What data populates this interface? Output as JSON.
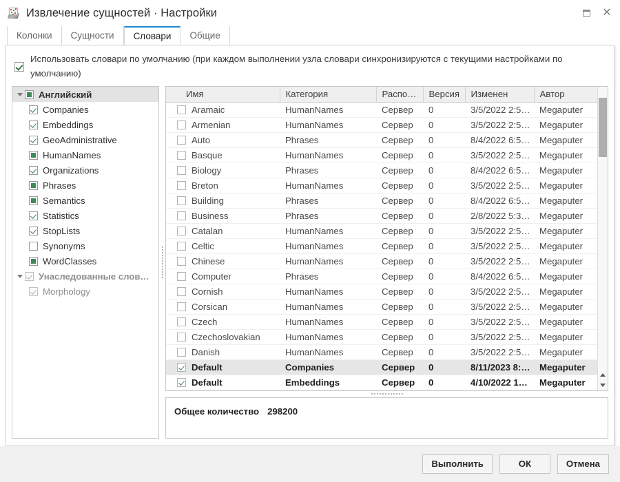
{
  "window": {
    "title": "Извлечение сущностей · Настройки",
    "icon": "app-icon",
    "restore_label": "▣",
    "close_label": "✕"
  },
  "tabs": [
    {
      "label": "Колонки",
      "active": false
    },
    {
      "label": "Сущности",
      "active": false
    },
    {
      "label": "Словари",
      "active": true
    },
    {
      "label": "Общие",
      "active": false
    }
  ],
  "default_dicts": {
    "checked": true,
    "label": "Использовать словари по умолчанию (при каждом выполнении узла словари синхронизируются с текущими настройками по умолчанию)"
  },
  "tree": [
    {
      "label": "Английский",
      "state": "filled",
      "level": 0,
      "expanded": true,
      "selected": true,
      "dim": false
    },
    {
      "label": "Companies",
      "state": "checked",
      "level": 1,
      "dim": false
    },
    {
      "label": "Embeddings",
      "state": "checked",
      "level": 1,
      "dim": false
    },
    {
      "label": "GeoAdministrative",
      "state": "checked",
      "level": 1,
      "dim": false
    },
    {
      "label": "HumanNames",
      "state": "filled",
      "level": 1,
      "dim": false
    },
    {
      "label": "Organizations",
      "state": "checked",
      "level": 1,
      "dim": false
    },
    {
      "label": "Phrases",
      "state": "filled",
      "level": 1,
      "dim": false
    },
    {
      "label": "Semantics",
      "state": "filled",
      "level": 1,
      "dim": false
    },
    {
      "label": "Statistics",
      "state": "checked",
      "level": 1,
      "dim": false
    },
    {
      "label": "StopLists",
      "state": "checked",
      "level": 1,
      "dim": false
    },
    {
      "label": "Synonyms",
      "state": "unchecked",
      "level": 1,
      "dim": false
    },
    {
      "label": "WordClasses",
      "state": "filled",
      "level": 1,
      "dim": false
    },
    {
      "label": "Унаследованные слов…",
      "state": "checked-disabled",
      "level": 0,
      "expanded": true,
      "bold": true,
      "dim": true
    },
    {
      "label": "Morphology",
      "state": "checked-disabled",
      "level": 1,
      "dim": true
    }
  ],
  "table": {
    "columns": [
      "Имя",
      "Категория",
      "Распо…",
      "Версия",
      "Изменен",
      "Автор"
    ],
    "rows": [
      {
        "checked": false,
        "name": "Aramaic",
        "category": "HumanNames",
        "location": "Сервер",
        "version": "0",
        "modified": "3/5/2022 2:5…",
        "author": "Megaputer"
      },
      {
        "checked": false,
        "name": "Armenian",
        "category": "HumanNames",
        "location": "Сервер",
        "version": "0",
        "modified": "3/5/2022 2:5…",
        "author": "Megaputer"
      },
      {
        "checked": false,
        "name": "Auto",
        "category": "Phrases",
        "location": "Сервер",
        "version": "0",
        "modified": "8/4/2022 6:5…",
        "author": "Megaputer"
      },
      {
        "checked": false,
        "name": "Basque",
        "category": "HumanNames",
        "location": "Сервер",
        "version": "0",
        "modified": "3/5/2022 2:5…",
        "author": "Megaputer"
      },
      {
        "checked": false,
        "name": "Biology",
        "category": "Phrases",
        "location": "Сервер",
        "version": "0",
        "modified": "8/4/2022 6:5…",
        "author": "Megaputer"
      },
      {
        "checked": false,
        "name": "Breton",
        "category": "HumanNames",
        "location": "Сервер",
        "version": "0",
        "modified": "3/5/2022 2:5…",
        "author": "Megaputer"
      },
      {
        "checked": false,
        "name": "Building",
        "category": "Phrases",
        "location": "Сервер",
        "version": "0",
        "modified": "8/4/2022 6:5…",
        "author": "Megaputer"
      },
      {
        "checked": false,
        "name": "Business",
        "category": "Phrases",
        "location": "Сервер",
        "version": "0",
        "modified": "2/8/2022 5:3…",
        "author": "Megaputer"
      },
      {
        "checked": false,
        "name": "Catalan",
        "category": "HumanNames",
        "location": "Сервер",
        "version": "0",
        "modified": "3/5/2022 2:5…",
        "author": "Megaputer"
      },
      {
        "checked": false,
        "name": "Celtic",
        "category": "HumanNames",
        "location": "Сервер",
        "version": "0",
        "modified": "3/5/2022 2:5…",
        "author": "Megaputer"
      },
      {
        "checked": false,
        "name": "Chinese",
        "category": "HumanNames",
        "location": "Сервер",
        "version": "0",
        "modified": "3/5/2022 2:5…",
        "author": "Megaputer"
      },
      {
        "checked": false,
        "name": "Computer",
        "category": "Phrases",
        "location": "Сервер",
        "version": "0",
        "modified": "8/4/2022 6:5…",
        "author": "Megaputer"
      },
      {
        "checked": false,
        "name": "Cornish",
        "category": "HumanNames",
        "location": "Сервер",
        "version": "0",
        "modified": "3/5/2022 2:5…",
        "author": "Megaputer"
      },
      {
        "checked": false,
        "name": "Corsican",
        "category": "HumanNames",
        "location": "Сервер",
        "version": "0",
        "modified": "3/5/2022 2:5…",
        "author": "Megaputer"
      },
      {
        "checked": false,
        "name": "Czech",
        "category": "HumanNames",
        "location": "Сервер",
        "version": "0",
        "modified": "3/5/2022 2:5…",
        "author": "Megaputer"
      },
      {
        "checked": false,
        "name": "Czechoslovakian",
        "category": "HumanNames",
        "location": "Сервер",
        "version": "0",
        "modified": "3/5/2022 2:5…",
        "author": "Megaputer"
      },
      {
        "checked": false,
        "name": "Danish",
        "category": "HumanNames",
        "location": "Сервер",
        "version": "0",
        "modified": "3/5/2022 2:5…",
        "author": "Megaputer"
      },
      {
        "checked": true,
        "name": "Default",
        "category": "Companies",
        "location": "Сервер",
        "version": "0",
        "modified": "8/11/2023 8:…",
        "author": "Megaputer",
        "bold": true,
        "highlighted": true
      },
      {
        "checked": true,
        "name": "Default",
        "category": "Embeddings",
        "location": "Сервер",
        "version": "0",
        "modified": "4/10/2022 1…",
        "author": "Megaputer",
        "bold": true
      }
    ]
  },
  "summary": {
    "label": "Общее количество",
    "value": "298200"
  },
  "footer": {
    "execute_label": "Выполнить",
    "ok_label": "ОК",
    "cancel_label": "Отмена"
  }
}
